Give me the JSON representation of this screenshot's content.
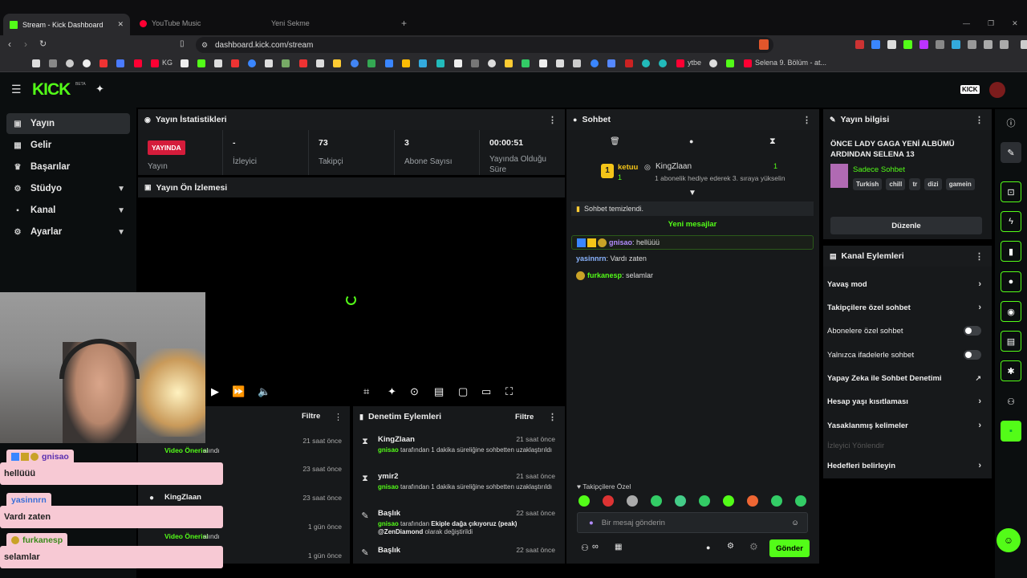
{
  "browser": {
    "tabs": [
      {
        "title": "Stream - Kick Dashboard"
      },
      {
        "title": "YouTube Music"
      },
      {
        "title": "Yeni Sekme"
      }
    ],
    "url": "dashboard.kick.com/stream",
    "bookmarks": [
      "KG",
      "ytbe",
      "Selena 9. Bölüm - at..."
    ]
  },
  "brand": {
    "logo": "KICK",
    "beta": "BETA",
    "accent": "#53fc18"
  },
  "sidebar": {
    "items": [
      {
        "label": "Yayın",
        "icon": "video-icon"
      },
      {
        "label": "Gelir",
        "icon": "income-icon"
      },
      {
        "label": "Başarılar",
        "icon": "trophy-icon"
      },
      {
        "label": "Stüdyo",
        "icon": "studio-icon"
      },
      {
        "label": "Kanal",
        "icon": "channel-icon"
      },
      {
        "label": "Ayarlar",
        "icon": "gear-icon"
      }
    ]
  },
  "stats": {
    "title": "Yayın İstatistikleri",
    "live_badge": "YAYINDA",
    "live_label": "Yayın",
    "viewers_value": "-",
    "viewers_label": "İzleyici",
    "followers_value": "73",
    "followers_label": "Takipçi",
    "subs_value": "3",
    "subs_label": "Abone Sayısı",
    "duration_value": "00:00:51",
    "duration_label": "Yayında Olduğu Süre"
  },
  "preview": {
    "title": "Yayın Ön İzlemesi"
  },
  "activity": {
    "filter": "Filtre",
    "rows": [
      {
        "time": "21 saat önce",
        "action": "Video Önerisi",
        "suffix": "alındı"
      },
      {
        "time": "23 saat önce"
      },
      {
        "name": "KingZlaan",
        "time": "23 saat önce"
      },
      {
        "time": "1 gün önce",
        "action": "Video Önerisi",
        "suffix": "alındı"
      },
      {
        "time": "1 gün önce"
      }
    ]
  },
  "moderation": {
    "title": "Denetim Eylemleri",
    "filter": "Filtre",
    "rows": [
      {
        "name": "KingZlaan",
        "time": "21 saat önce",
        "actor": "gnisao",
        "text": "tarafından 1 dakika süreliğine sohbetten uzaklaştırıldı"
      },
      {
        "name": "ymir2",
        "time": "21 saat önce",
        "actor": "gnisao",
        "text": "tarafından 1 dakika süreliğine sohbetten uzaklaştırıldı"
      },
      {
        "name": "Başlık",
        "time": "22 saat önce",
        "actor": "gnisao",
        "text": "tarafından",
        "bold": "Ekiple dağa çıkıyoruz (peak) @ZenDiamond",
        "text2": "olarak değiştirildi"
      },
      {
        "name": "Başlık",
        "time": "22 saat önce"
      }
    ]
  },
  "chat": {
    "title": "Sohbet",
    "pinned_user": "ketuu",
    "pinned_count": "1",
    "gifter": "KingZlaan",
    "gift_count": "1",
    "gift_text": "1 abonelik hediye ederek 3. sıraya yükselin",
    "cleared": "Sohbet temizlendi.",
    "new_messages": "Yeni mesajlar",
    "messages": [
      {
        "user": "gnisao",
        "text": "hellüüü",
        "color": "#b38cff"
      },
      {
        "user": "yasinnrn",
        "text": "Vardı zaten",
        "color": "#8ab4ff"
      },
      {
        "user": "furkanesp",
        "text": "selamlar",
        "color": "#53fc18"
      }
    ],
    "followers_only": "Takipçilere Özel",
    "input_placeholder": "Bir mesaj gönderin",
    "send": "Gönder"
  },
  "info": {
    "title": "Yayın bilgisi",
    "stream_title": "ÖNCE LADY GAGA YENİ ALBÜMÜ ARDINDAN SELENA 13",
    "category": "Sadece Sohbet",
    "tags": [
      "Turkish",
      "chill",
      "tr",
      "dizi",
      "gamein"
    ],
    "edit": "Düzenle"
  },
  "channel_actions": {
    "title": "Kanal Eylemleri",
    "items": [
      {
        "label": "Yavaş mod",
        "type": "chevron"
      },
      {
        "label": "Takipçilere özel sohbet",
        "type": "chevron"
      },
      {
        "label": "Abonelere özel sohbet",
        "type": "toggle"
      },
      {
        "label": "Yalnızca ifadelerle sohbet",
        "type": "toggle"
      },
      {
        "label": "Yapay Zeka ile Sohbet Denetimi",
        "type": "external"
      },
      {
        "label": "Hesap yaşı kısıtlaması",
        "type": "chevron"
      },
      {
        "label": "Yasaklanmış kelimeler",
        "type": "chevron"
      },
      {
        "label": "İzleyici Yönlendir",
        "type": "disabled"
      },
      {
        "label": "Hedefleri belirleyin",
        "type": "chevron"
      }
    ]
  },
  "overlay": {
    "chat": [
      {
        "user": "gnisao",
        "text": "hellüüü"
      },
      {
        "user": "yasinnrn",
        "text": "Vardı zaten"
      },
      {
        "user": "furkanesp",
        "text": "selamlar"
      }
    ]
  },
  "topright": {
    "badge": "KICK"
  }
}
